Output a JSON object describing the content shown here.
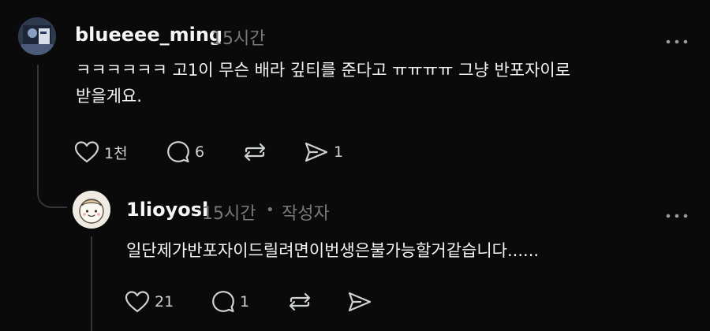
{
  "comment": {
    "username": "blueeee_ming",
    "time": "15시간",
    "text_line1": "ㅋㅋㅋㅋㅋㅋ 고1이 무슨 배라 깊티를 준다고 ㅠㅠㅠㅠ 그냥 반포자이로",
    "text_line2": "받을게요.",
    "actions": {
      "likes": "1천",
      "replies": "6",
      "reposts": "",
      "shares": "1"
    },
    "icons": [
      "avatar",
      "more-icon",
      "heart-icon",
      "comment-icon",
      "repost-icon",
      "share-icon"
    ]
  },
  "reply": {
    "username": "1lioyosl",
    "time": "15시간",
    "separator": "•",
    "author_badge": "작성자",
    "text": "일단제가반포자이드릴려면이번생은불가능할거같습니다......",
    "actions": {
      "likes": "21",
      "replies": "1",
      "reposts": "",
      "shares": ""
    }
  },
  "colors": {
    "background": "#0a0a0a",
    "text": "#f3f5f7",
    "secondary": "#777a7c",
    "icon": "#cfd2d4",
    "thread_line": "#333638"
  }
}
